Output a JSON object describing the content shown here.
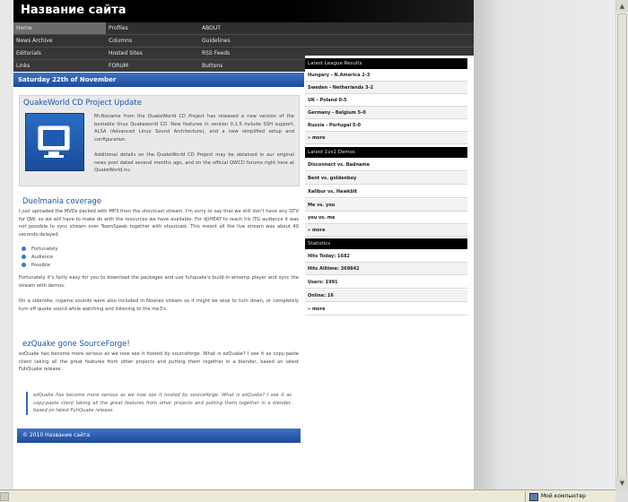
{
  "site": {
    "title": "Название сайта"
  },
  "nav": {
    "col1": [
      "Home",
      "News Archive",
      "Editorials",
      "Links"
    ],
    "col2": [
      "Profiles",
      "Columns",
      "Hosted Sites",
      "FORUM"
    ],
    "col3": [
      "ABOUT",
      "Guidelines",
      "RSS Feeds",
      "Buttons"
    ]
  },
  "main": {
    "date": "Saturday 22th of November",
    "post1": {
      "title": "QuakeWorld CD Project Update",
      "p1": "Mr.Noname from the QuakeWorld CD Project has released a new version of the bootable linux Quakeworld CD. New features in version 0.1.5 include SSH support, ALSA (Advanced Linux Sound Architecture), and a new simplified setup and configuration.",
      "p2": "Additional details on the QuakeWorld CD Project may be obtained in our original news post dated several months ago, and on the official QWCD forums right here at QuakeWorld.nu."
    },
    "post2": {
      "title": "Duelmania coverage",
      "p1": "I just uploaded the MVDs packed with MP3 from the shoutcast stream. I'm sorry to say that we still don't have any QTV for QW, so we will have to make do with the resources we have available. For dj\\HEAT to reach his ITG audience it was not possible to sync stream over TeamSpeak together with shoutcast. This meant all the live stream was about 40 seconds delayed.",
      "bullets": [
        "Fortunately",
        "Audience",
        "Possible"
      ],
      "p2": "Fortunately it's fairly easy for you to download the packages and use fuhquake's build-in winamp player and sync the stream with demos.",
      "p3": "On a sidenote, ingame sounds were also included in Noones stream so it might be wise to turn down, or completely turn off quake sound while watching and listening to the mp3's."
    },
    "post3": {
      "title": "ezQuake gone SourceForge!",
      "p1": "ezQuake has become more serious as we now see it hosted by sourceforge. What is ezQuake? I see it as copy-paste client taking all the great features from other projects and putting them together in a blender, based on latest FuhQuake release.",
      "quote": "ezQuake has become more serious as we now see it hosted by sourceforge. What is ezQuake? I see it as copy-paste client taking all the great features from other projects and putting them together in a blender, based on latest FuhQuake release."
    },
    "footer": "© 2010 Название сайта"
  },
  "sidebar": {
    "league": {
      "title": "Latest League Results",
      "items": [
        "Hungary - N.America 2-3",
        "Sweden - Netherlands 3-2",
        "UK - Poland 0-5",
        "Germany - Belgium 5-0",
        "Russia - Portugal 5-0"
      ],
      "more": "» more"
    },
    "demos": {
      "title": "Latest 1vs1 Demos",
      "items": [
        "Disconnect vs. Badname",
        "Bent vs. goldenboy",
        "Xalibur vs. Hawkbit",
        "Me vs. you",
        "you vs. me"
      ],
      "more": "» more"
    },
    "stats": {
      "title": "Statistics",
      "items": [
        "Hits Today: 1682",
        "Hits Alltime: 369842",
        "Users: 1991",
        "Online: 16"
      ],
      "more": "» more"
    }
  },
  "statusbar": {
    "zone": "Мой компьютер"
  }
}
